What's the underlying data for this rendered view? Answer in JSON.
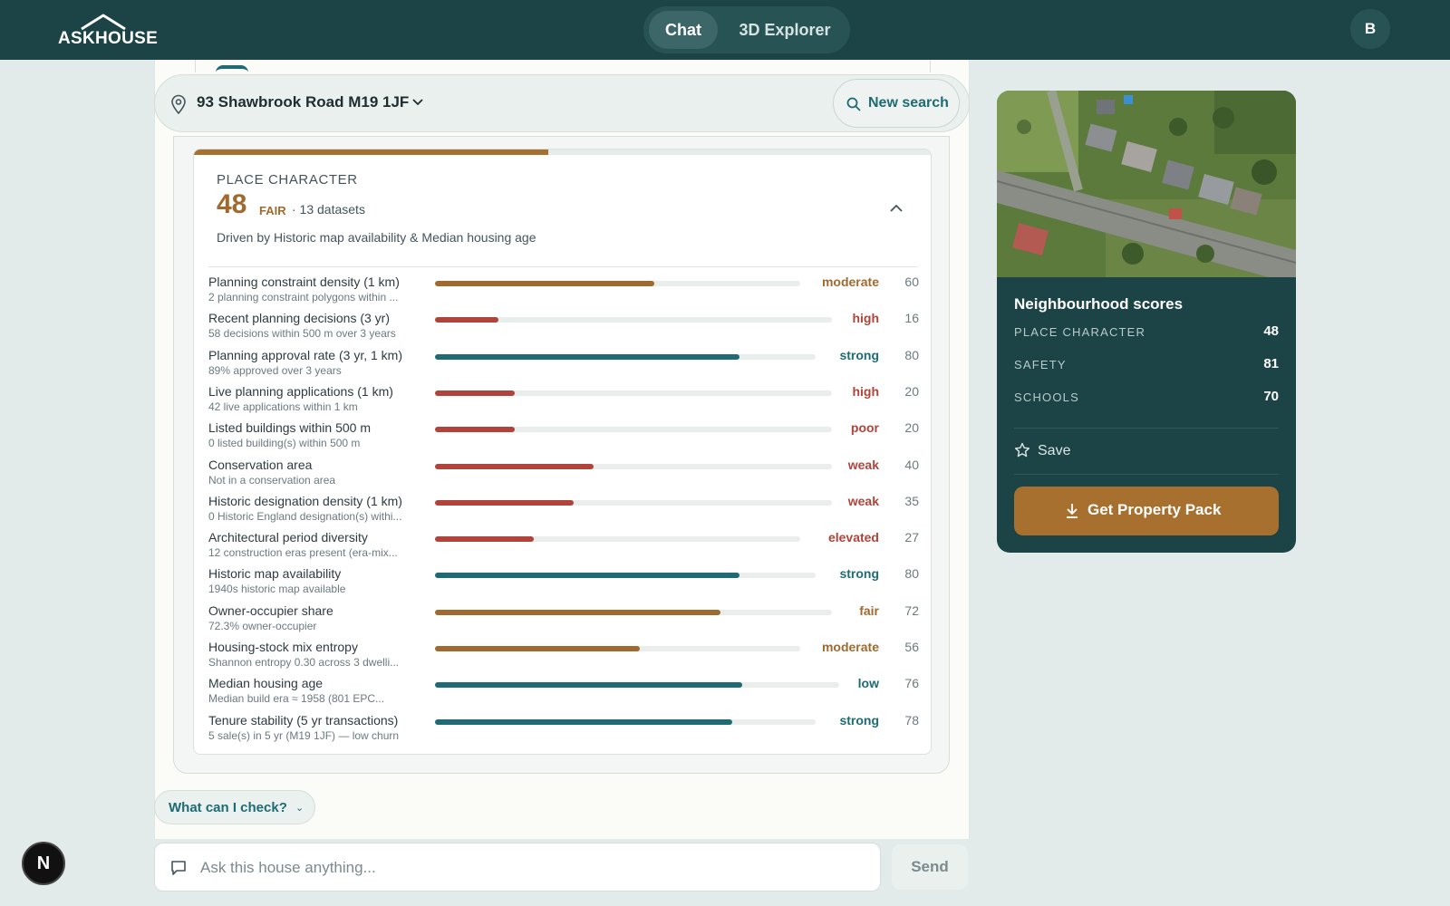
{
  "app": {
    "logo_text": "ASKHOUSE",
    "avatar_initial": "B",
    "dev_badge": "N"
  },
  "nav": {
    "tabs": [
      {
        "label": "Chat",
        "active": true
      },
      {
        "label": "3D Explorer",
        "active": false
      }
    ]
  },
  "address_bar": {
    "address": "93 Shawbrook Road M19 1JF",
    "new_search_label": "New search"
  },
  "place_character": {
    "title": "PLACE CHARACTER",
    "score": "48",
    "band": "FAIR",
    "datasets": "· 13 datasets",
    "driven_by": "Driven by Historic map availability & Median housing age",
    "progress": 48,
    "metrics": [
      {
        "label": "Planning constraint density (1 km)",
        "sub": "2 planning constraint polygons within ...",
        "band": "moderate",
        "value": "60",
        "tone": "amber"
      },
      {
        "label": "Recent planning decisions (3 yr)",
        "sub": "58 decisions within 500 m over 3 years",
        "band": "high",
        "value": "16",
        "tone": "red"
      },
      {
        "label": "Planning approval rate (3 yr, 1 km)",
        "sub": "89% approved over 3 years",
        "band": "strong",
        "value": "80",
        "tone": "teal"
      },
      {
        "label": "Live planning applications (1 km)",
        "sub": "42 live applications within 1 km",
        "band": "high",
        "value": "20",
        "tone": "red"
      },
      {
        "label": "Listed buildings within 500 m",
        "sub": "0 listed building(s) within 500 m",
        "band": "poor",
        "value": "20",
        "tone": "red"
      },
      {
        "label": "Conservation area",
        "sub": "Not in a conservation area",
        "band": "weak",
        "value": "40",
        "tone": "red"
      },
      {
        "label": "Historic designation density (1 km)",
        "sub": "0 Historic England designation(s) withi...",
        "band": "weak",
        "value": "35",
        "tone": "red"
      },
      {
        "label": "Architectural period diversity",
        "sub": "12 construction eras present (era-mix...",
        "band": "elevated",
        "value": "27",
        "tone": "red"
      },
      {
        "label": "Historic map availability",
        "sub": "1940s historic map available",
        "band": "strong",
        "value": "80",
        "tone": "teal"
      },
      {
        "label": "Owner-occupier share",
        "sub": "72.3% owner-occupier",
        "band": "fair",
        "value": "72",
        "tone": "amber"
      },
      {
        "label": "Housing-stock mix entropy",
        "sub": "Shannon entropy 0.30 across 3 dwelli...",
        "band": "moderate",
        "value": "56",
        "tone": "amber"
      },
      {
        "label": "Median housing age",
        "sub": "Median build era ≈ 1958 (801 EPC...",
        "band": "low",
        "value": "76",
        "tone": "teal"
      },
      {
        "label": "Tenure stability (5 yr transactions)",
        "sub": "5 sale(s) in 5 yr (M19 1JF) — low churn",
        "band": "strong",
        "value": "78",
        "tone": "teal"
      }
    ]
  },
  "suggest": {
    "label": "What can I check?",
    "chevron": "⌄"
  },
  "composer": {
    "placeholder": "Ask this house anything...",
    "send_label": "Send"
  },
  "side_panel": {
    "title": "Neighbourhood scores",
    "scores": [
      {
        "label": "PLACE CHARACTER",
        "value": "48"
      },
      {
        "label": "SAFETY",
        "value": "81"
      },
      {
        "label": "SCHOOLS",
        "value": "70"
      }
    ],
    "save_label": "Save",
    "pack_label": "Get Property Pack"
  },
  "colors": {
    "teal": "#1e6b74",
    "red": "#b0443a",
    "amber": "#a06a2e",
    "brand_dark": "#1c4446",
    "accent": "#a8702f"
  },
  "icons": [
    "home-roof-icon",
    "location-pin-icon",
    "chevron-down-icon",
    "search-icon",
    "chevron-up-icon",
    "chat-bubble-icon",
    "star-icon",
    "download-icon"
  ]
}
